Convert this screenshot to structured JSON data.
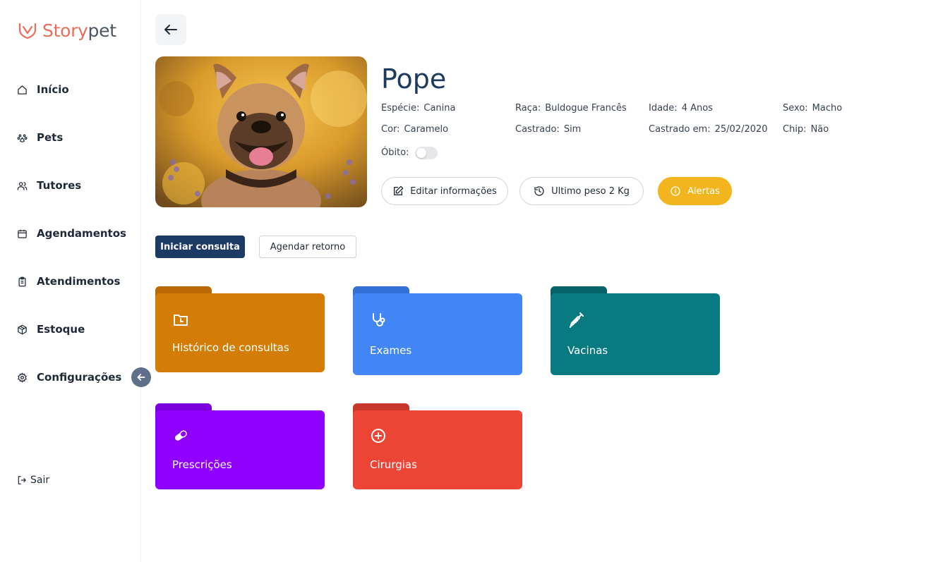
{
  "app": {
    "logo_part1": "Story",
    "logo_part2": "pet"
  },
  "sidebar": {
    "items": [
      {
        "label": "Início",
        "icon": "home-icon"
      },
      {
        "label": "Pets",
        "icon": "paw-icon"
      },
      {
        "label": "Tutores",
        "icon": "users-icon"
      },
      {
        "label": "Agendamentos",
        "icon": "calendar-icon"
      },
      {
        "label": "Atendimentos",
        "icon": "clipboard-icon"
      },
      {
        "label": "Estoque",
        "icon": "box-icon"
      },
      {
        "label": "Configurações",
        "icon": "gear-icon"
      }
    ],
    "logout_label": "Sair"
  },
  "pet": {
    "name": "Pope",
    "fields": {
      "especie_label": "Espécie:",
      "especie": "Canina",
      "raca_label": "Raça:",
      "raca": "Buldogue Francês",
      "idade_label": "Idade:",
      "idade": "4 Anos",
      "sexo_label": "Sexo:",
      "sexo": "Macho",
      "cor_label": "Cor:",
      "cor": "Caramelo",
      "castrado_label": "Castrado:",
      "castrado": "Sim",
      "castrado_em_label": "Castrado em:",
      "castrado_em": "25/02/2020",
      "chip_label": "Chip:",
      "chip": "Não",
      "obito_label": "Óbito:"
    },
    "obito": false
  },
  "actions": {
    "edit_label": "Editar informações",
    "weight_label": "Ultimo peso 2 Kg",
    "alerts_label": "Alertas",
    "start_consult_label": "Iniciar consulta",
    "schedule_return_label": "Agendar retorno"
  },
  "folders": [
    {
      "label": "Histórico de consultas",
      "icon": "folder-clock-icon",
      "color": "#d47d06",
      "tab_color": "#b96a04"
    },
    {
      "label": "Exames",
      "icon": "stethoscope-icon",
      "color": "#4285f4",
      "tab_color": "#3270d6"
    },
    {
      "label": "Vacinas",
      "icon": "syringe-icon",
      "color": "#087b80",
      "tab_color": "#066468"
    },
    {
      "label": "Prescrições",
      "icon": "pill-icon",
      "color": "#8f00ff",
      "tab_color": "#7a00dc"
    },
    {
      "label": "Cirurgias",
      "icon": "plus-circle-icon",
      "color": "#ec4536",
      "tab_color": "#c9362a"
    }
  ],
  "colors": {
    "brand": "#e56f5a",
    "primary": "#1c3a63",
    "alert": "#f3b51e"
  }
}
